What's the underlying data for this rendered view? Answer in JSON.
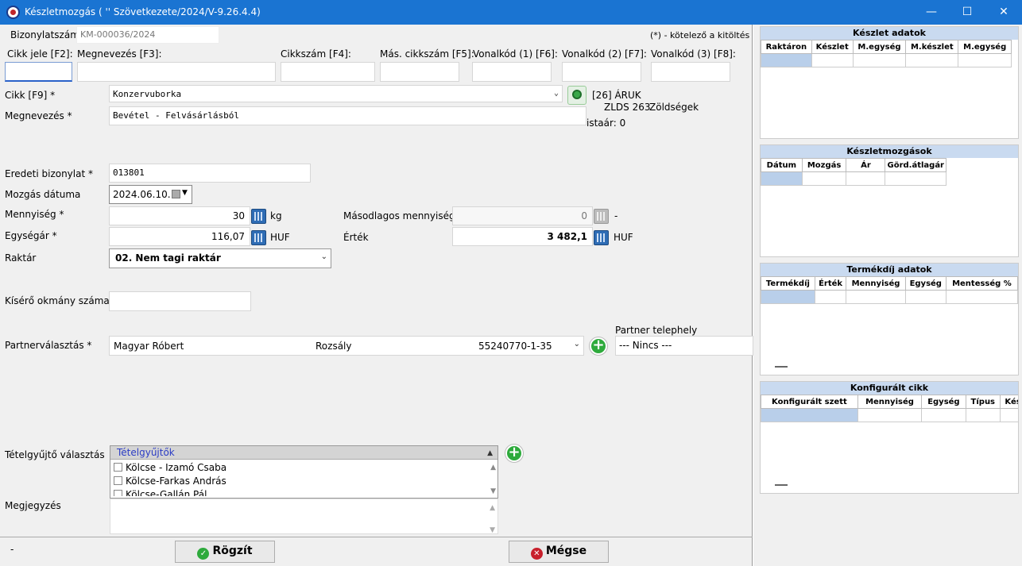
{
  "window": {
    "title": "Készletmozgás (                     '' Szövetkezete/2024/V-9.26.4.4)",
    "minimize": "—",
    "maximize": "☐",
    "close": "✕"
  },
  "header": {
    "doc_label": "Bizonylatszám",
    "doc_number": "KM-000036/2024",
    "required_note": "(*) - kötelező a kitöltés"
  },
  "search": {
    "labels": [
      "Cikk jele [F2]:",
      "Megnevezés [F3]:",
      "Cikkszám [F4]:",
      "Más. cikkszám [F5]:",
      "Vonalkód (1) [F6]:",
      "Vonalkód (2) [F7]:",
      "Vonalkód (3) [F8]:"
    ]
  },
  "form": {
    "item_label": "Cikk [F9] *",
    "item_value": "Konzervuborka",
    "item_info_1": "[26] ÁRUK",
    "item_info_2": "ZLDS 263",
    "item_info_3": "Zöldségek",
    "item_info_4": "istaár: 0",
    "name_label": "Megnevezés *",
    "name_value": "Bevétel - Felvásárlásból",
    "orig_doc_label": "Eredeti bizonylat *",
    "orig_doc_value": "013801",
    "date_label": "Mozgás dátuma",
    "date_value": "2024.06.10.",
    "qty_label": "Mennyiség *",
    "qty_value": "30",
    "qty_unit": "kg",
    "sec_qty_label": "Másodlagos mennyiség",
    "sec_qty_value": "0",
    "sec_qty_unit": "-",
    "unit_price_label": "Egységár *",
    "unit_price_value": "116,07",
    "unit_price_currency": "HUF",
    "value_label": "Érték",
    "value_value": "3 482,1",
    "value_currency": "HUF",
    "warehouse_label": "Raktár",
    "warehouse_value": "02. Nem tagi raktár",
    "accompany_label": "Kísérő okmány száma",
    "accompany_value": "",
    "partner_label": "Partnerválasztás *",
    "partner_name": "Magyar Róbert",
    "partner_city": "Rozsály",
    "partner_tax": "55240770-1-35",
    "site_label": "Partner telephely",
    "site_value": "--- Nincs ---",
    "collector_label": "Tételgyűjtő választás",
    "collector_header": "Tételgyűjtők",
    "collector_items": [
      "Kölcse - Izamó Csaba",
      "Kölcse-Farkas András",
      "Kölcse-Gallán Pál"
    ],
    "note_label": "Megjegyzés",
    "note_value": "",
    "status": "-"
  },
  "buttons": {
    "save": "Rögzít",
    "cancel": "Mégse"
  },
  "side": {
    "stock": {
      "title": "Készlet adatok",
      "columns": [
        "Raktáron",
        "Készlet",
        "M.egység",
        "M.készlet",
        "M.egység"
      ]
    },
    "movements": {
      "title": "Készletmozgások",
      "columns": [
        "Dátum",
        "Mozgás",
        "Ár",
        "Görd.átlagár"
      ]
    },
    "fee": {
      "title": "Termékdíj adatok",
      "columns": [
        "Termékdíj",
        "Érték",
        "Mennyiség",
        "Egység",
        "Mentesség %"
      ]
    },
    "config": {
      "title": "Konfigurált cikk",
      "columns": [
        "Konfigurált szett",
        "Mennyiség",
        "Egység",
        "Típus",
        "Kész"
      ]
    }
  }
}
